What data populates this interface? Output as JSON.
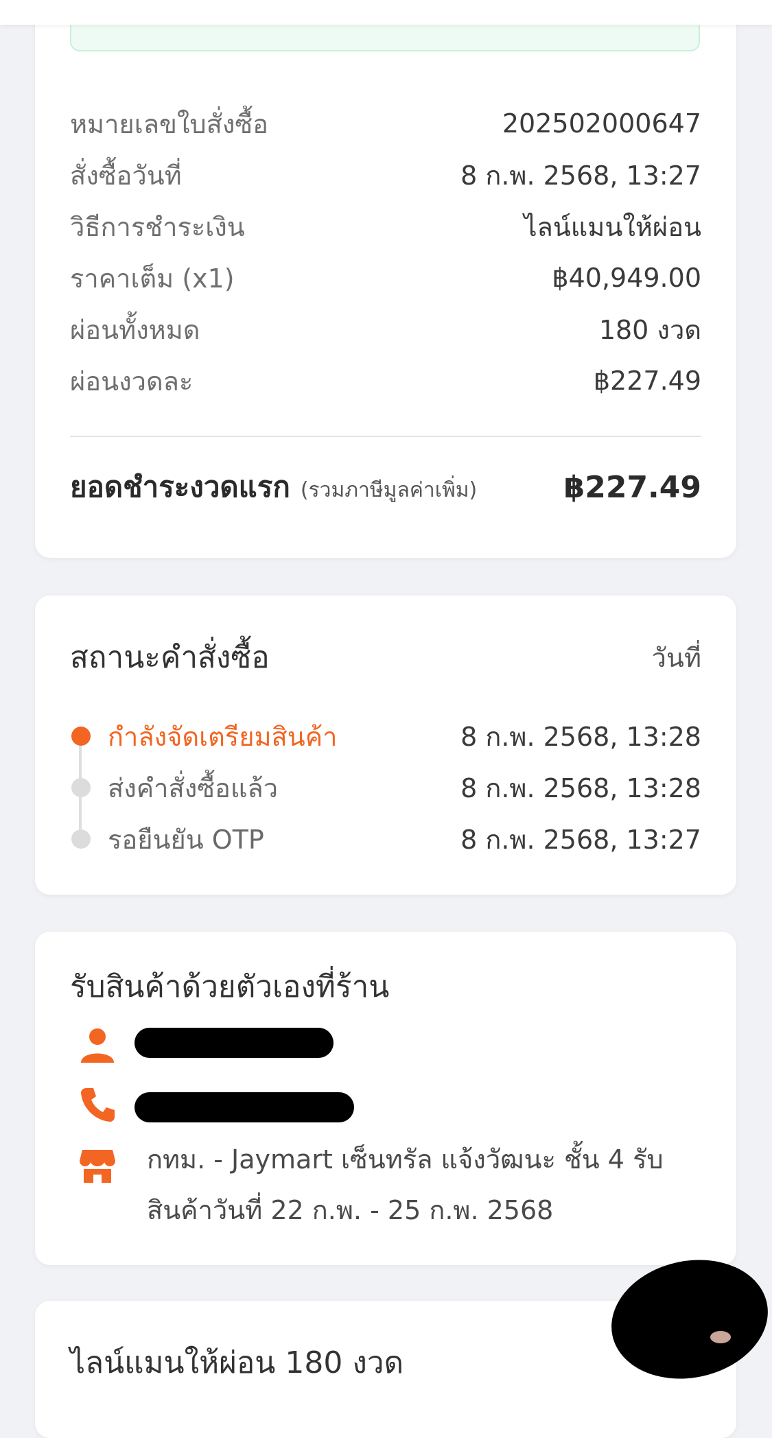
{
  "order_details": {
    "rows": [
      {
        "label": "หมายเลขใบสั่งซื้อ",
        "value": "202502000647"
      },
      {
        "label": "สั่งซื้อวันที่",
        "value": "8 ก.พ. 2568, 13:27"
      },
      {
        "label": "วิธีการชำระเงิน",
        "value": "ไลน์แมนให้ผ่อน"
      },
      {
        "label": "ราคาเต็ม (x1)",
        "value": "฿40,949.00"
      },
      {
        "label": "ผ่อนทั้งหมด",
        "value": "180 งวด"
      },
      {
        "label": "ผ่อนงวดละ",
        "value": "฿227.49"
      }
    ],
    "total_label": "ยอดชำระงวดแรก",
    "total_note": "(รวมภาษีมูลค่าเพิ่ม)",
    "total_value": "฿227.49"
  },
  "order_status": {
    "title": "สถานะคำสั่งซื้อ",
    "date_label": "วันที่",
    "steps": [
      {
        "name": "กำลังจัดเตรียมสินค้า",
        "time": "8 ก.พ. 2568, 13:28",
        "active": true
      },
      {
        "name": "ส่งคำสั่งซื้อแล้ว",
        "time": "8 ก.พ. 2568, 13:28",
        "active": false
      },
      {
        "name": "รอยืนยัน OTP",
        "time": "8 ก.พ. 2568, 13:27",
        "active": false
      }
    ]
  },
  "pickup": {
    "title": "รับสินค้าด้วยตัวเองที่ร้าน",
    "address_line1": "กทม. - Jaymart เซ็นทรัล แจ้งวัฒนะ ชั้น 4 รับ",
    "address_line2": "สินค้าวันที่ 22 ก.พ. - 25 ก.พ. 2568",
    "icons": [
      "person-icon",
      "phone-icon",
      "store-icon"
    ]
  },
  "plan": {
    "title": "ไลน์แมนให้ผ่อน 180 งวด"
  },
  "colors": {
    "accent": "#f26522",
    "success_bg": "#eefbf4",
    "page_bg": "#f1f2f5"
  }
}
